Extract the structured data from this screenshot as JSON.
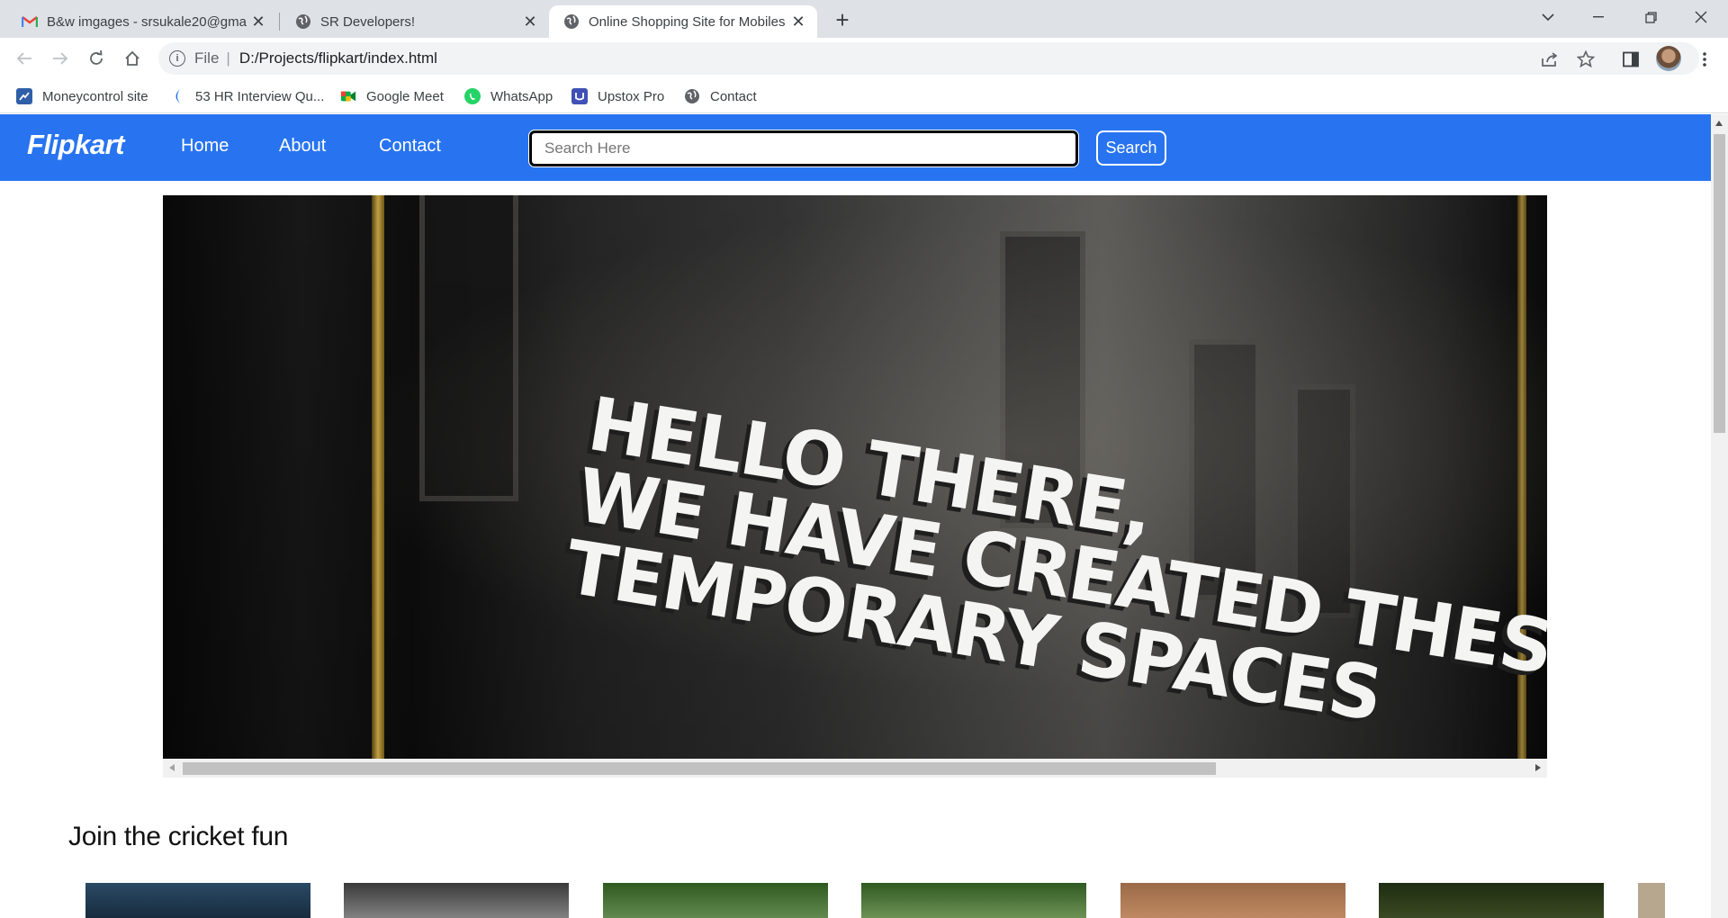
{
  "browser": {
    "tabs": [
      {
        "title": "B&w imgages - srsukale20@gma",
        "favicon": "gmail-icon",
        "active": false
      },
      {
        "title": "SR Developers!",
        "favicon": "globe-icon",
        "active": false
      },
      {
        "title": "Online Shopping Site for Mobiles",
        "favicon": "globe-icon",
        "active": true
      }
    ],
    "address": {
      "scheme": "File",
      "url": "D:/Projects/flipkart/index.html"
    },
    "bookmarks": [
      {
        "label": "Moneycontrol site",
        "icon": "moneycontrol-icon",
        "color": "#2f5fa8"
      },
      {
        "label": "53 HR Interview Qu...",
        "icon": "crescent-icon",
        "color": "#1a73e8"
      },
      {
        "label": "Google Meet",
        "icon": "google-meet-icon",
        "color": "#00897b"
      },
      {
        "label": "WhatsApp",
        "icon": "whatsapp-icon",
        "color": "#25d366"
      },
      {
        "label": "Upstox Pro",
        "icon": "upstox-icon",
        "color": "#3f51b5"
      },
      {
        "label": "Contact",
        "icon": "globe-icon",
        "color": "#5f6368"
      }
    ]
  },
  "site": {
    "brand": "Flipkart",
    "nav": [
      {
        "label": "Home"
      },
      {
        "label": "About"
      },
      {
        "label": "Contact"
      }
    ],
    "search": {
      "placeholder": "Search Here",
      "button": "Search"
    },
    "hero": {
      "lines": [
        "HELLO THERE,",
        "WE HAVE CREATED THESE",
        "TEMPORARY SPACES"
      ]
    },
    "section_title": "Join the cricket fun",
    "accent": "#2874f0"
  }
}
